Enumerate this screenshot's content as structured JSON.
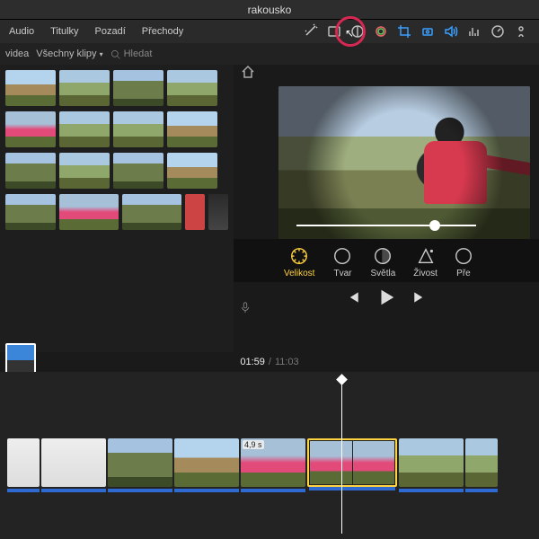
{
  "title": "rakousko",
  "tabs": {
    "audio": "Audio",
    "titles": "Titulky",
    "bg": "Pozadí",
    "trans": "Přechody"
  },
  "library": {
    "sidebar_hint": "videa",
    "filter": "Všechny klipy",
    "search_placeholder": "Hledat"
  },
  "filters": {
    "size": "Velikost",
    "shape": "Tvar",
    "light": "Světla",
    "color": "Živost",
    "extra": "Pře"
  },
  "time": {
    "current": "01:59",
    "total": "11:03"
  },
  "timeline": {
    "clip_duration_badge": "4,9 s"
  }
}
